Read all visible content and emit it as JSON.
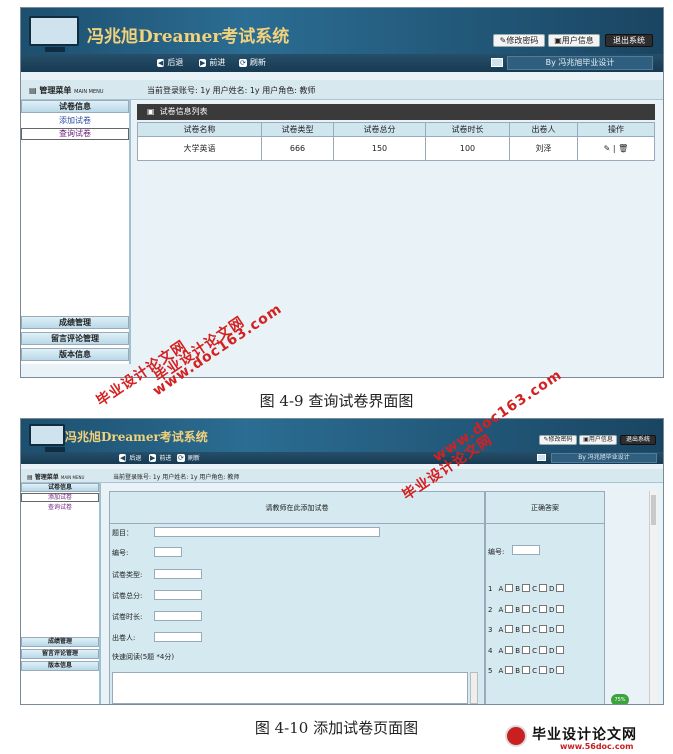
{
  "app": {
    "title": "冯兆旭Dreamer考试系统",
    "buttons": {
      "change_password": "修改密码",
      "user_info": "用户信息",
      "logout": "退出系统"
    },
    "nav": {
      "back": "后退",
      "forward": "前进",
      "refresh": "刷新"
    },
    "by_text": "By 冯兆旭毕业设计"
  },
  "sidebar": {
    "menu_title": "管理菜单",
    "menu_title_en": "MAIN MENU",
    "section_exam": "试卷信息",
    "items": [
      "添加试卷",
      "查询试卷"
    ],
    "section_grades": "成绩管理",
    "section_comments": "留言评论管理",
    "section_version": "版本信息"
  },
  "userbar": {
    "text": "当前登录账号: 1y   用户姓名: 1y   用户角色: 教师"
  },
  "fig1": {
    "list_title": "试卷信息列表",
    "columns": [
      "试卷名称",
      "试卷类型",
      "试卷总分",
      "试卷时长",
      "出卷人",
      "操作"
    ],
    "rows": [
      {
        "name": "大学英语",
        "type": "666",
        "total": "150",
        "duration": "100",
        "author": "刘泽"
      }
    ],
    "caption": "图 4-9 查询试卷界面图"
  },
  "fig2": {
    "form_title": "请教师在此添加试卷",
    "answer_title": "正确答案",
    "fields": {
      "topic": "题目：",
      "number": "编号:",
      "type": "试卷类型:",
      "total": "试卷总分:",
      "duration": "试卷时长:",
      "author": "出卷人:"
    },
    "quick_read": "快速阅读(5题  *4分)",
    "answer_number": "编号:",
    "answers": [
      "1",
      "2",
      "3",
      "4",
      "5"
    ],
    "options": [
      "A",
      "B",
      "C",
      "D"
    ],
    "caption": "图 4-10 添加试卷页面图",
    "zoom_badge": "75%"
  },
  "watermarks": {
    "cn": "毕业设计论文网",
    "url": "www.doc163.com",
    "logo_cn": "毕业设计论文网",
    "logo_url": "www.56doc.com"
  }
}
